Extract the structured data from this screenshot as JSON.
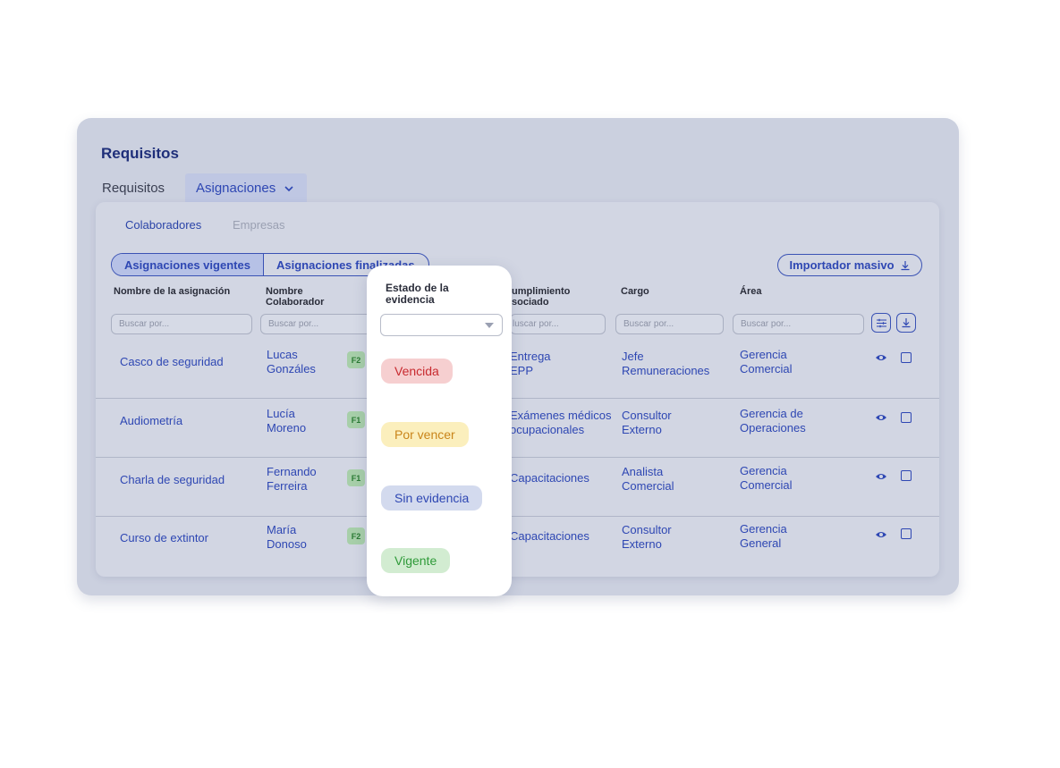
{
  "page": {
    "title": "Requisitos",
    "tabs": [
      "Requisitos",
      "Asignaciones"
    ],
    "active_tab": "Asignaciones"
  },
  "subtabs": {
    "active": "Colaboradores",
    "inactive": "Empresas"
  },
  "segmented": {
    "on": "Asignaciones vigentes",
    "off": "Asignaciones finalizadas"
  },
  "import_button": "Importador masivo",
  "columns": {
    "nombre_asignacion": "Nombre de la asignación",
    "colaborador_1": "Nombre",
    "colaborador_2": "Colaborador",
    "cumplimiento_1": "umplimiento",
    "cumplimiento_2": "sociado",
    "cargo": "Cargo",
    "area": "Área"
  },
  "search_placeholder": "Buscar por...",
  "search_placeholder_cut": "luscar por...",
  "rows": [
    {
      "asignacion": "Casco de seguridad",
      "colab_1": "Lucas",
      "colab_2": "Gonzáles",
      "badge": "F2",
      "req_1": "Entrega",
      "req_2": "EPP",
      "cargo_1": "Jefe",
      "cargo_2": "Remuneraciones",
      "area_1": "Gerencia",
      "area_2": "Comercial"
    },
    {
      "asignacion": "Audiometría",
      "colab_1": "Lucía",
      "colab_2": "Moreno",
      "badge": "F1",
      "req_1": "Exámenes médicos",
      "req_2": "ocupacionales",
      "cargo_1": "Consultor",
      "cargo_2": "Externo",
      "area_1": "Gerencia de",
      "area_2": "Operaciones"
    },
    {
      "asignacion": "Charla de seguridad",
      "colab_1": "Fernando",
      "colab_2": "Ferreira",
      "badge": "F1",
      "req_1": "Capacitaciones",
      "req_2": "",
      "cargo_1": "Analista",
      "cargo_2": "Comercial",
      "area_1": "Gerencia",
      "area_2": "Comercial"
    },
    {
      "asignacion": "Curso de extintor",
      "colab_1": "María",
      "colab_2": "Donoso",
      "badge": "F2",
      "req_1": "Capacitaciones",
      "req_2": "",
      "cargo_1": "Consultor",
      "cargo_2": "Externo",
      "area_1": "Gerencia",
      "area_2": "General"
    }
  ],
  "popup": {
    "title": "Estado de la evidencia",
    "select_value": "",
    "options": [
      "Vencida",
      "Por vencer",
      "Sin evidencia",
      "Vigente"
    ]
  },
  "colors": {
    "accent": "#2e47b3",
    "vencida": "#c82a2f",
    "por_vencer": "#c9851a",
    "sin_evidencia": "#2e47b3",
    "vigente": "#2f9a39"
  },
  "icons": [
    "chevron-down-icon",
    "download-icon",
    "filter-icon",
    "eye-icon",
    "checkbox-icon"
  ]
}
